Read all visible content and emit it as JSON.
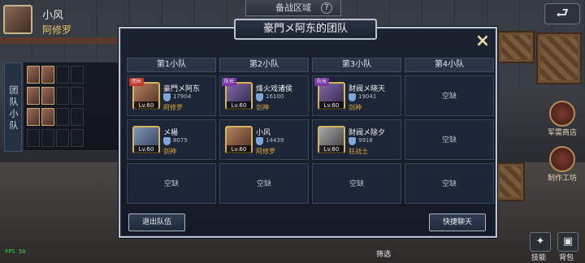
{
  "header": {
    "zone_title": "备战区域",
    "help_label": "?",
    "back_label": "⮐"
  },
  "player": {
    "name": "小风",
    "class": "阿修罗"
  },
  "side_tabs": {
    "label": "团 队  小 队"
  },
  "right_panel": {
    "shop_label": "军需商店",
    "work_label": "制作工坊"
  },
  "bottom": {
    "fps_label": "FPS 50",
    "center_label": "筛选",
    "skill_label": "技能",
    "bag_label": "背包"
  },
  "modal": {
    "title": "豪門メ阿东的团队",
    "close_icon": "×",
    "leave_button": "退出队伍",
    "chat_button": "快捷聊天",
    "squads": [
      {
        "label": "第1小队",
        "slots": [
          {
            "badge": "团长",
            "badge_color": "red",
            "name": "豪門メ阿东",
            "power": "17904",
            "class": "阿修罗",
            "level": "Lv.60",
            "portrait": "gold"
          },
          {
            "badge": "",
            "name": "メ楊",
            "power": "8075",
            "class": "剑神",
            "level": "Lv.60",
            "portrait": "blue"
          },
          {
            "empty": "空缺"
          }
        ]
      },
      {
        "label": "第2小队",
        "slots": [
          {
            "badge": "队长",
            "badge_color": "purple",
            "name": "烽火戏诸侯",
            "power": "16100",
            "class": "剑神",
            "level": "Lv.60",
            "portrait": "purple"
          },
          {
            "badge": "",
            "name": "小风",
            "power": "14439",
            "class": "阿修罗",
            "level": "Lv.60",
            "portrait": "gold"
          },
          {
            "empty": "空缺"
          }
        ]
      },
      {
        "label": "第3小队",
        "slots": [
          {
            "badge": "队长",
            "badge_color": "purple",
            "name": "财阀メ晓天",
            "power": "19041",
            "class": "剑神",
            "level": "Lv.60",
            "portrait": "purple"
          },
          {
            "badge": "",
            "name": "财阀メ除夕",
            "power": "9918",
            "class": "狂战士",
            "level": "Lv.60",
            "portrait": "grey"
          },
          {
            "empty": "空缺"
          }
        ]
      },
      {
        "label": "第4小队",
        "slots": [
          {
            "empty": "空缺"
          },
          {
            "empty": "空缺"
          },
          {
            "empty": "空缺"
          }
        ]
      }
    ]
  }
}
